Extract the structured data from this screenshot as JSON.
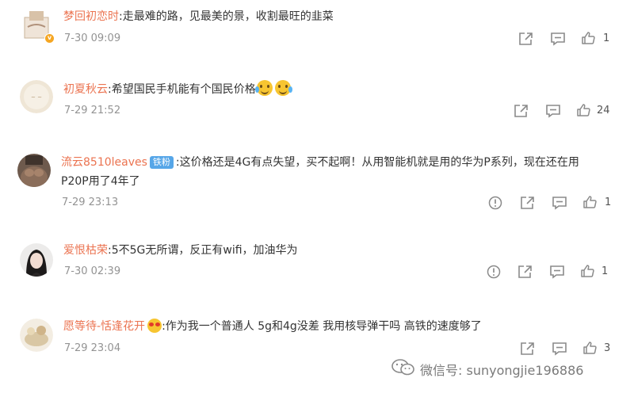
{
  "comments": [
    {
      "username": "梦回初恋时",
      "text": ":走最难的路，见最美的景，收割最旺的韭菜",
      "time": "7-30 09:09",
      "likes": "1",
      "verified": true
    },
    {
      "username": "初夏秋云",
      "text": ":希望国民手机能有个国民价格",
      "time": "7-29 21:52",
      "likes": "24"
    },
    {
      "username": "流云8510leaves",
      "badge": "铁粉",
      "text_line1": ":这价格还是4G有点失望，买不起啊！从用智能机就是用的华为P系列，现在还在用",
      "text_line2": "P20P用了4年了",
      "time": "7-29 23:13",
      "likes": "1"
    },
    {
      "username": "爱恨枯荣",
      "text": ":5不5G无所谓，反正有wifi，加油华为",
      "time": "7-30 02:39",
      "likes": "1"
    },
    {
      "username": "愿等待-恬逢花开",
      "text": ":作为我一个普通人 5g和4g没差 我用核导弹干吗 高铁的速度够了",
      "time": "7-29 23:04",
      "likes": "3"
    }
  ],
  "watermark": {
    "text": "微信号: sunyongjie196886"
  },
  "icons": {
    "share": "share-icon",
    "comment": "comment-icon",
    "like": "thumbs-up-icon",
    "report": "report-icon",
    "wechat": "wechat-icon"
  },
  "colors": {
    "username": "#eb7350",
    "meta": "#939393",
    "badge": "#56a6e8"
  }
}
